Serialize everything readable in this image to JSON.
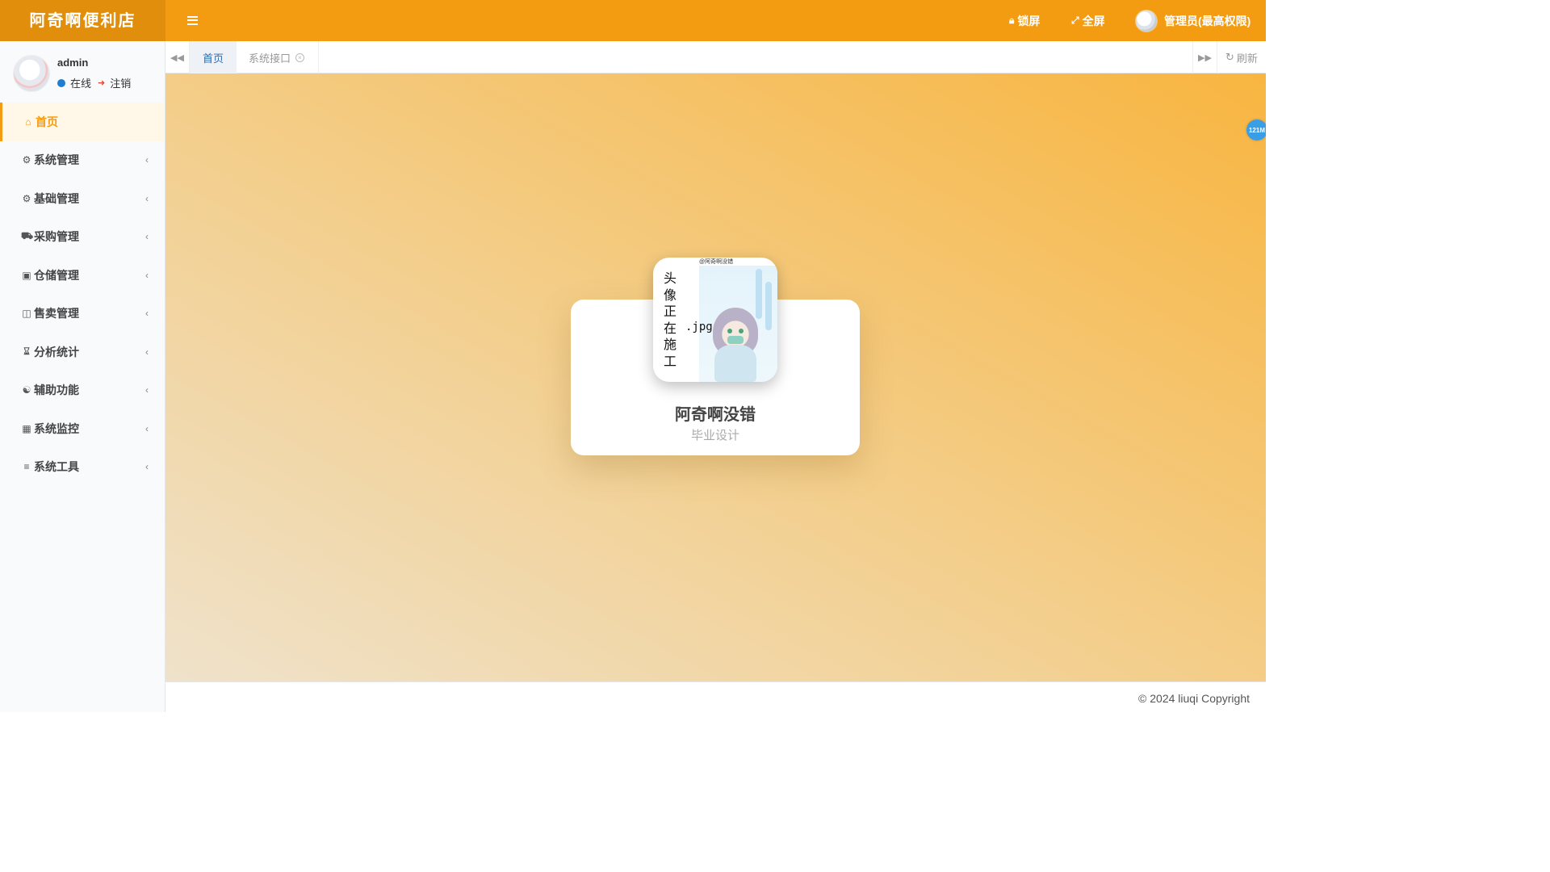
{
  "header": {
    "logo": "阿奇啊便利店",
    "lock_label": "锁屏",
    "fullscreen_label": "全屏",
    "user_label": "管理员(最高权限)",
    "color": "#f39c12"
  },
  "sidebar": {
    "username": "admin",
    "status": "在线",
    "logout": "注销",
    "items": [
      {
        "label": "首页",
        "icon": "home-icon"
      },
      {
        "label": "系统管理",
        "icon": "gear-icon"
      },
      {
        "label": "基础管理",
        "icon": "gears-icon"
      },
      {
        "label": "采购管理",
        "icon": "truck-icon"
      },
      {
        "label": "仓储管理",
        "icon": "cubes-icon"
      },
      {
        "label": "售卖管理",
        "icon": "shopping-bag-icon"
      },
      {
        "label": "分析统计",
        "icon": "hourglass-icon"
      },
      {
        "label": "辅助功能",
        "icon": "handshake-icon"
      },
      {
        "label": "系统监控",
        "icon": "video-camera-icon"
      },
      {
        "label": "系统工具",
        "icon": "bars-icon"
      }
    ]
  },
  "tabs": {
    "items": [
      {
        "label": "首页"
      },
      {
        "label": "系统接口"
      }
    ],
    "refresh": "刷新"
  },
  "main": {
    "memory_badge": "121M",
    "profile": {
      "name": "阿奇啊没错",
      "subtitle": "毕业设计",
      "avatar_text": "头像正在施工",
      "avatar_suffix": ".jpg",
      "avatar_top": "@阿奇啊没错"
    }
  },
  "footer": {
    "copyright": "© 2024 liuqi Copyright"
  }
}
